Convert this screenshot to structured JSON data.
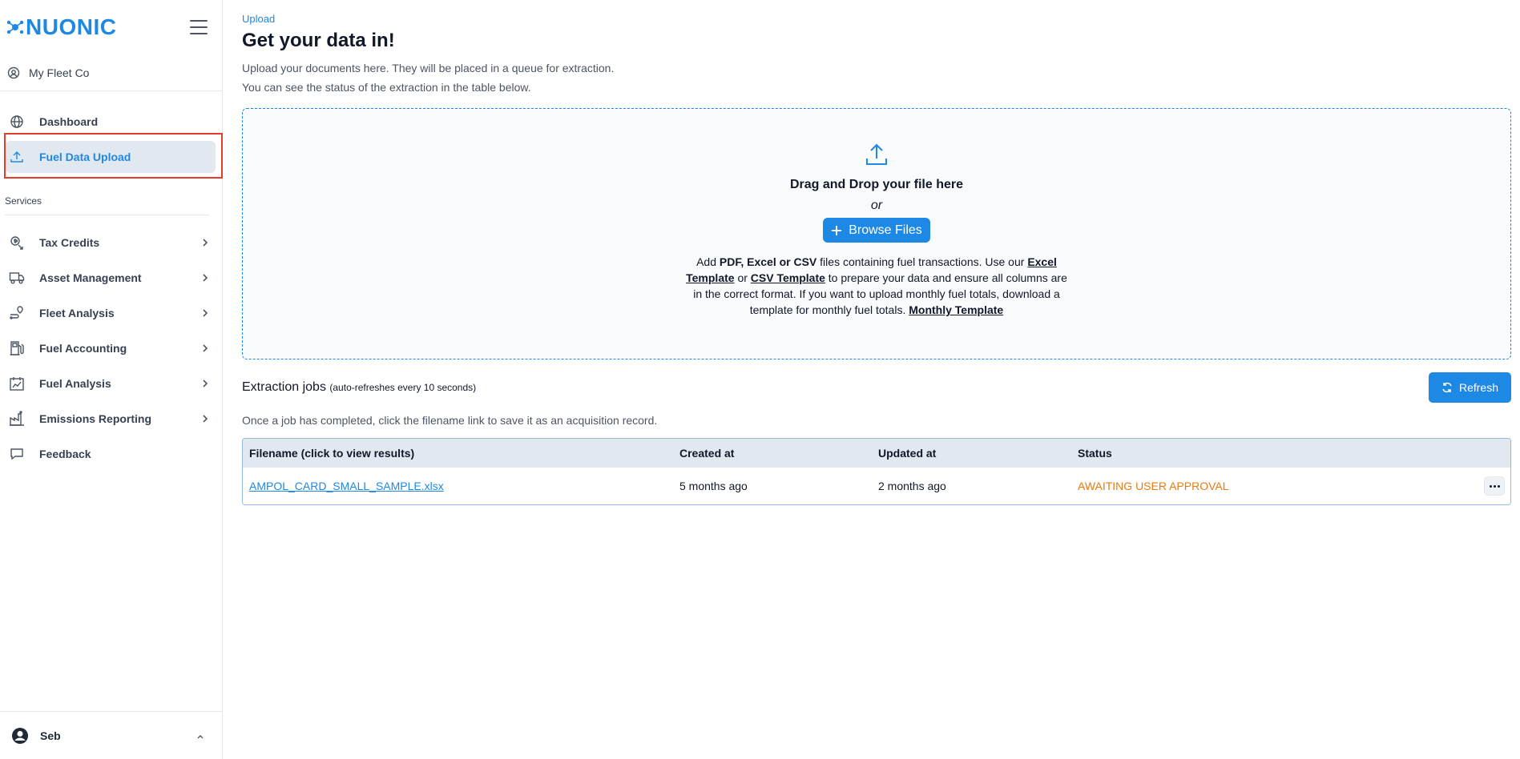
{
  "brand": {
    "name": "NUONIC",
    "color": "#1e88e5"
  },
  "org": {
    "name": "My Fleet Co",
    "icon": "fleet-org-icon"
  },
  "nav_primary": [
    {
      "label": "Dashboard",
      "icon": "globe-icon"
    },
    {
      "label": "Fuel Data Upload",
      "icon": "upload-icon",
      "active": true
    }
  ],
  "services_label": "Services",
  "nav_services": [
    {
      "label": "Tax Credits",
      "icon": "tax-credits-icon"
    },
    {
      "label": "Asset Management",
      "icon": "truck-icon"
    },
    {
      "label": "Fleet Analysis",
      "icon": "route-icon"
    },
    {
      "label": "Fuel Accounting",
      "icon": "fuel-pump-icon"
    },
    {
      "label": "Fuel Analysis",
      "icon": "calendar-chart-icon"
    },
    {
      "label": "Emissions Reporting",
      "icon": "factory-icon"
    }
  ],
  "feedback": {
    "label": "Feedback",
    "icon": "chat-icon"
  },
  "user": {
    "name": "Seb"
  },
  "page": {
    "breadcrumb": "Upload",
    "title": "Get your data in!",
    "desc_line1": "Upload your documents here. They will be placed in a queue for extraction.",
    "desc_line2": "You can see the status of the extraction in the table below."
  },
  "dropzone": {
    "title": "Drag and Drop your file here",
    "or": "or",
    "browse_label": "Browse Files",
    "help": {
      "t1": "Add ",
      "b1": "PDF, Excel or CSV",
      "t2": " files containing fuel transactions. Use our ",
      "link1": "Excel Template",
      "t3": " or ",
      "link2": "CSV Template",
      "t4": " to prepare your data and ensure all columns are in the correct format. If you want to upload monthly fuel totals, download a template for monthly fuel totals. ",
      "link3": "Monthly Template"
    }
  },
  "jobs": {
    "title": "Extraction jobs",
    "subtitle": "(auto-refreshes every 10 seconds)",
    "refresh_label": "Refresh",
    "note": "Once a job has completed, click the filename link to save it as an acquisition record.",
    "columns": [
      "Filename (click to view results)",
      "Created at",
      "Updated at",
      "Status"
    ],
    "rows": [
      {
        "filename": "AMPOL_CARD_SMALL_SAMPLE.xlsx",
        "created": "5 months ago",
        "updated": "2 months ago",
        "status": "AWAITING USER APPROVAL"
      }
    ],
    "status_color": "#ea7a10"
  }
}
